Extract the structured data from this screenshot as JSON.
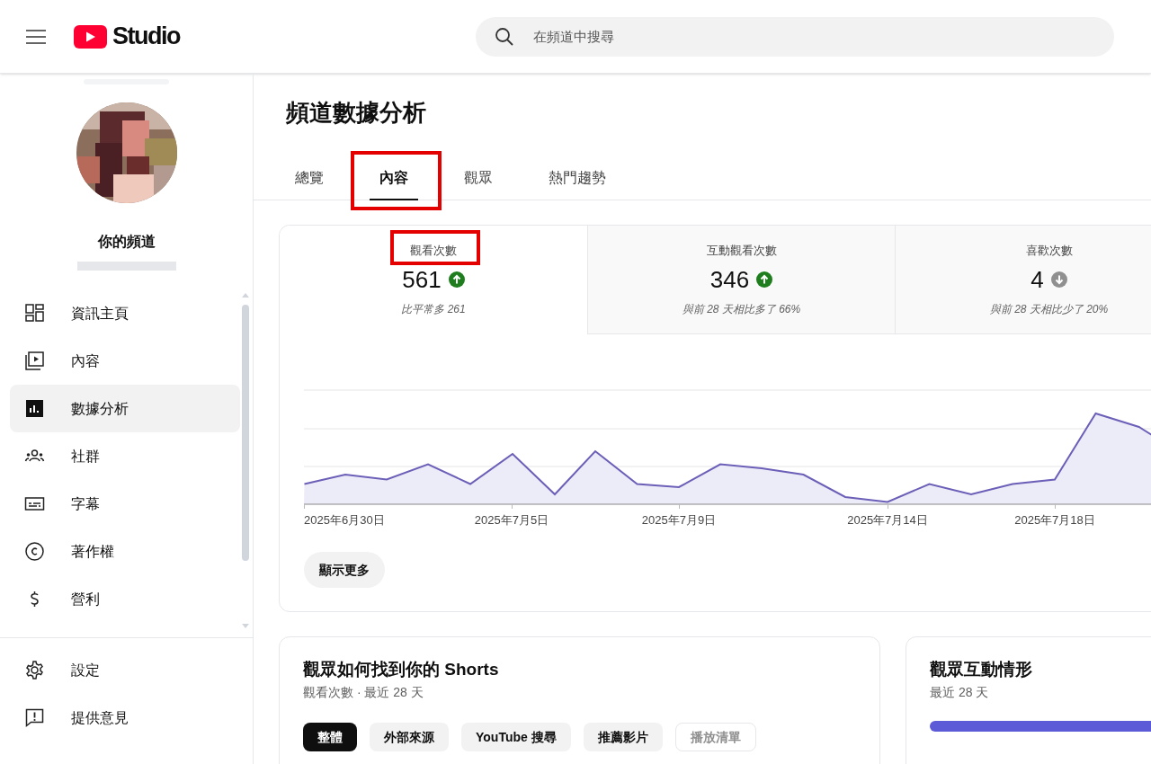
{
  "header": {
    "logo_text": "Studio",
    "search": {
      "placeholder": "在頻道中搜尋"
    }
  },
  "channel": {
    "name": "你的頻道"
  },
  "sidebar": {
    "items": [
      {
        "label": "資訊主頁",
        "kind": "dashboard",
        "selected": false
      },
      {
        "label": "內容",
        "kind": "content",
        "selected": false
      },
      {
        "label": "數據分析",
        "kind": "analytics",
        "selected": true
      },
      {
        "label": "社群",
        "kind": "community",
        "selected": false
      },
      {
        "label": "字幕",
        "kind": "subtitles",
        "selected": false
      },
      {
        "label": "著作權",
        "kind": "copyright",
        "selected": false
      },
      {
        "label": "營利",
        "kind": "money",
        "selected": false
      }
    ],
    "footer_items": [
      {
        "label": "設定",
        "kind": "settings"
      },
      {
        "label": "提供意見",
        "kind": "feedback"
      }
    ]
  },
  "page": {
    "title": "頻道數據分析"
  },
  "tabs": [
    {
      "label": "總覽",
      "selected": false,
      "highlighted": false
    },
    {
      "label": "內容",
      "selected": true,
      "highlighted": true
    },
    {
      "label": "觀眾",
      "selected": false,
      "highlighted": false
    },
    {
      "label": "熱門趨勢",
      "selected": false,
      "highlighted": false
    }
  ],
  "metrics": [
    {
      "label": "觀看次數",
      "value": "561",
      "kind": "up",
      "comparison": "比平常多 261",
      "selected": true,
      "highlighted": true
    },
    {
      "label": "互動觀看次數",
      "value": "346",
      "kind": "up",
      "comparison": "與前 28 天相比多了 66%",
      "selected": false,
      "highlighted": false
    },
    {
      "label": "喜歡次數",
      "value": "4",
      "kind": "down",
      "comparison": "與前 28 天相比少了 20%",
      "selected": false,
      "highlighted": false
    }
  ],
  "chart": {
    "x_labels": [
      "2025年6月30日",
      "2025年7月5日",
      "2025年7月9日",
      "2025年7月14日",
      "2025年7月18日"
    ]
  },
  "show_more": "顯示更多",
  "cards": [
    {
      "kind": "chips",
      "title": "觀眾如何找到你的 Shorts",
      "subtitle": "觀看次數 · 最近 28 天",
      "chips": [
        {
          "label": "整體",
          "selected": true,
          "disabled": false
        },
        {
          "label": "外部來源",
          "selected": false,
          "disabled": false
        },
        {
          "label": "YouTube 搜尋",
          "selected": false,
          "disabled": false
        },
        {
          "label": "推薦影片",
          "selected": false,
          "disabled": false
        },
        {
          "label": "播放清單",
          "selected": false,
          "disabled": true
        }
      ]
    },
    {
      "kind": "bar",
      "title": "觀眾互動情形",
      "subtitle": "最近 28 天"
    }
  ]
}
